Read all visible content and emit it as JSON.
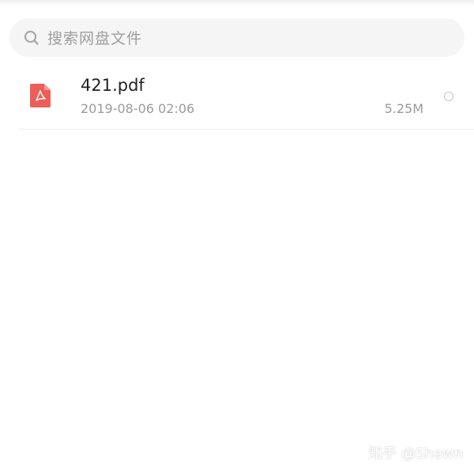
{
  "search": {
    "placeholder": "搜索网盘文件",
    "icon": "search-icon"
  },
  "files": [
    {
      "name": "421.pdf",
      "date": "2019-08-06 02:06",
      "size": "5.25M",
      "icon": "pdf-file-icon",
      "selected": false
    }
  ],
  "colors": {
    "pdf_red": "#ec5f59",
    "search_bg": "#f5f5f5",
    "secondary_text": "#9a9a9a"
  },
  "watermark": "知乎 @Shawn"
}
